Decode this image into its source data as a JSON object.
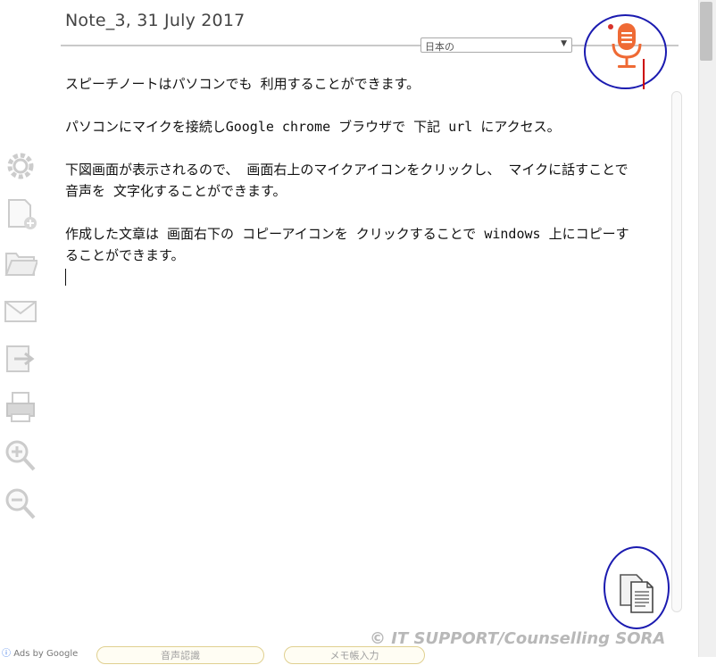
{
  "note": {
    "title": "Note_3, 31 July 2017",
    "paragraphs": [
      "スピーチノートはパソコンでも 利用することができます。",
      "パソコンにマイクを接続しGoogle chrome ブラウザで 下記 url にアクセス。",
      "下図画面が表示されるので、 画面右上のマイクアイコンをクリックし、 マイクに話すことで 音声を 文字化することができます。",
      "作成した文章は 画面右下の コピーアイコンを クリックすることで windows 上にコピーすることができます。"
    ]
  },
  "language_select": {
    "value": "日本の"
  },
  "toolbar": {
    "icons": [
      "gear-icon",
      "new-note-icon",
      "folder-icon",
      "mail-icon",
      "export-icon",
      "print-icon",
      "zoom-in-icon",
      "zoom-out-icon"
    ]
  },
  "footer": {
    "watermark": "©  IT SUPPORT/Counselling  SORA",
    "ads_label": "Ads by Google",
    "button_1": "音声認識",
    "button_2": "メモ帳入力"
  },
  "colors": {
    "circle": "#1b1bb0",
    "mic": "#ef6a35",
    "cursor": "#cc0000"
  }
}
